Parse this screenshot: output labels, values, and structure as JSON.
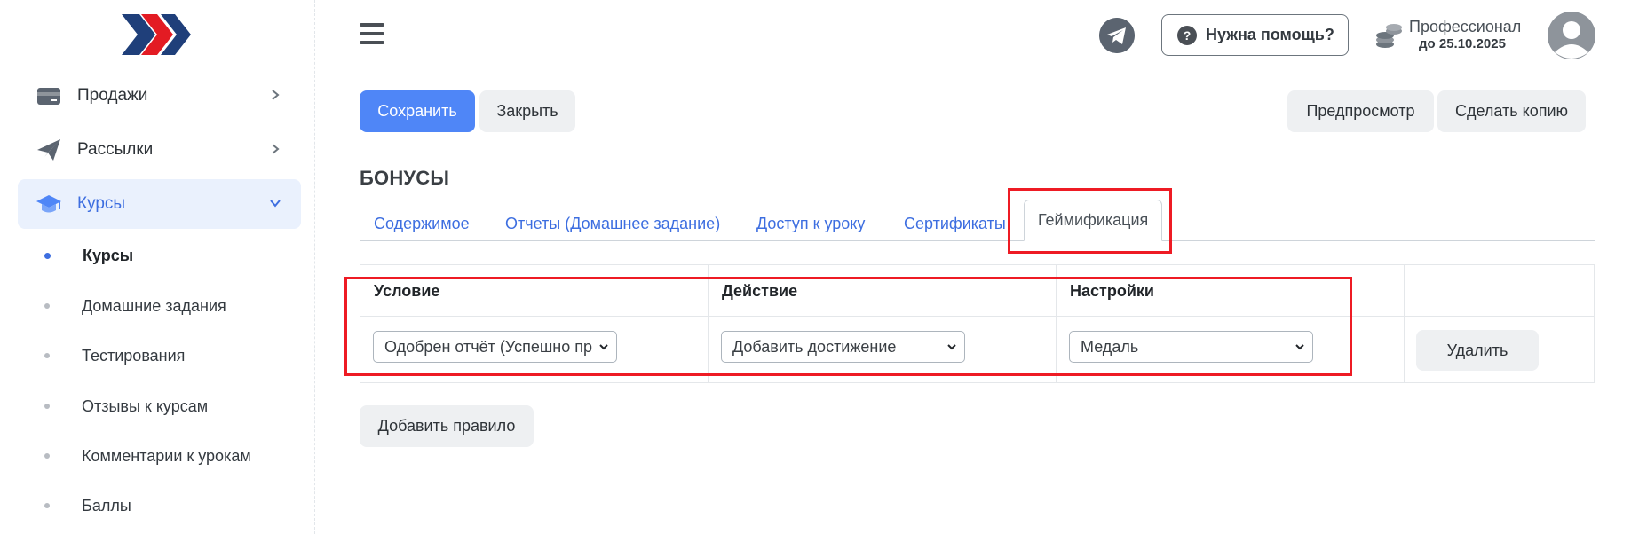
{
  "sidebar": {
    "items": [
      {
        "label": "Продажи"
      },
      {
        "label": "Рассылки"
      },
      {
        "label": "Курсы"
      }
    ],
    "sub_items": [
      {
        "label": "Курсы"
      },
      {
        "label": "Домашние задания"
      },
      {
        "label": "Тестирования"
      },
      {
        "label": "Отзывы к курсам"
      },
      {
        "label": "Комментарии к урокам"
      },
      {
        "label": "Баллы"
      }
    ]
  },
  "header": {
    "help_label": "Нужна помощь?",
    "plan_name": "Профессионал",
    "plan_until": "до 25.10.2025"
  },
  "toolbar": {
    "save_label": "Сохранить",
    "close_label": "Закрыть",
    "preview_label": "Предпросмотр",
    "copy_label": "Сделать копию"
  },
  "page": {
    "title": "БОНУСЫ"
  },
  "tabs": [
    {
      "label": "Содержимое"
    },
    {
      "label": "Отчеты (Домашнее задание)"
    },
    {
      "label": "Доступ к уроку"
    },
    {
      "label": "Сертификаты"
    },
    {
      "label": "Геймификация"
    }
  ],
  "rules_table": {
    "headers": [
      "Условие",
      "Действие",
      "Настройки"
    ],
    "rows": [
      {
        "condition": "Одобрен отчёт (Успешно пр",
        "action": "Добавить достижение",
        "setting": "Медаль",
        "delete_label": "Удалить"
      }
    ],
    "add_rule_label": "Добавить правило"
  },
  "colors": {
    "accent": "#4f86f7",
    "highlight": "#ee1b24",
    "link": "#3d6ee0"
  }
}
